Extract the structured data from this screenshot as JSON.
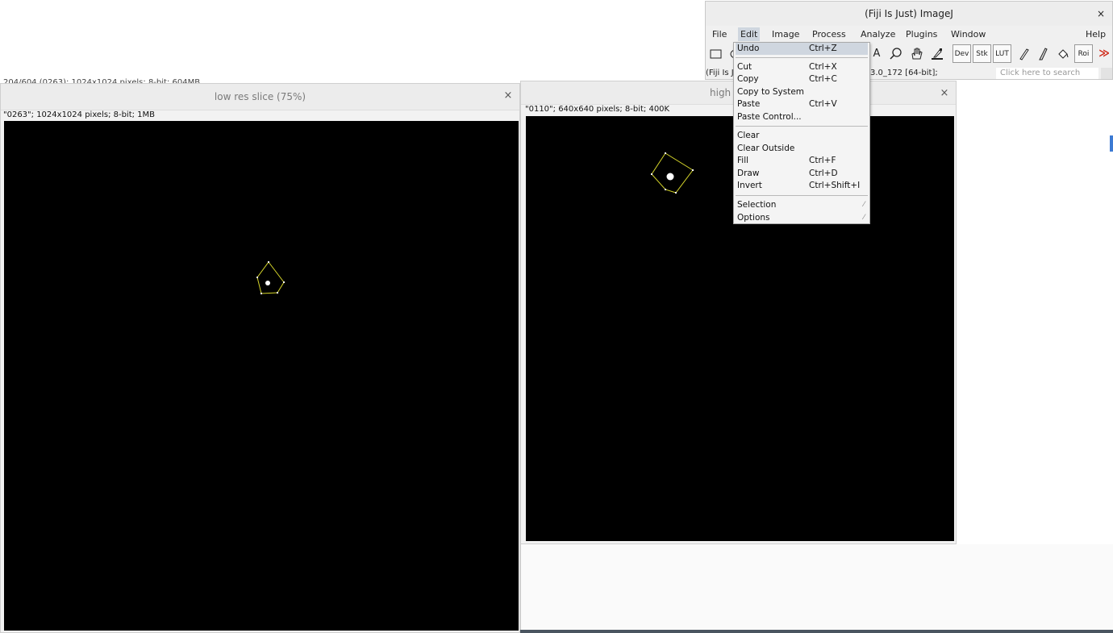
{
  "background_window": {
    "status_text": "204/604 (0263); 1024x1024 pixels; 8-bit; 604MB"
  },
  "low_res_window": {
    "title": "low res slice (75%)",
    "close_glyph": "×",
    "info": "\"0263\"; 1024x1024 pixels; 8-bit; 1MB"
  },
  "high_res_window": {
    "title": "high r",
    "close_glyph": "×",
    "info": "\"0110\"; 640x640 pixels; 8-bit; 400K"
  },
  "imagej": {
    "title": "(Fiji Is Just) ImageJ",
    "close_glyph": "×",
    "menu": [
      "File",
      "Edit",
      "Image",
      "Process",
      "Analyze",
      "Plugins",
      "Window",
      "Help"
    ],
    "active_menu": "Edit",
    "toolbar": {
      "text_tool": "A",
      "dev": "Dev",
      "stk": "Stk",
      "lut": "LUT",
      "roi": "Roi",
      "more_tools_glyph": "≫"
    },
    "status_left": "(Fiji Is J",
    "status_mid": "3.0_172 [64-bit];",
    "search_placeholder": "Click here to search"
  },
  "edit_menu": {
    "items": [
      {
        "label": "Undo",
        "shortcut": "Ctrl+Z"
      },
      {
        "label": "Cut",
        "shortcut": "Ctrl+X"
      },
      {
        "label": "Copy",
        "shortcut": "Ctrl+C"
      },
      {
        "label": "Copy to System",
        "shortcut": ""
      },
      {
        "label": "Paste",
        "shortcut": "Ctrl+V"
      },
      {
        "label": "Paste Control...",
        "shortcut": ""
      },
      {
        "label": "Clear",
        "shortcut": ""
      },
      {
        "label": "Clear Outside",
        "shortcut": ""
      },
      {
        "label": "Fill",
        "shortcut": "Ctrl+F"
      },
      {
        "label": "Draw",
        "shortcut": "Ctrl+D"
      },
      {
        "label": "Invert",
        "shortcut": "Ctrl+Shift+I"
      },
      {
        "label": "Selection",
        "shortcut": ""
      },
      {
        "label": "Options",
        "shortcut": ""
      }
    ],
    "submenu_glyph": "⁄"
  },
  "colors": {
    "roi_outline": "#d6d62a",
    "roi_handle": "#ffffff",
    "menu_highlight": "#cfd6df",
    "more_tools_arrow": "#d02a1a"
  }
}
